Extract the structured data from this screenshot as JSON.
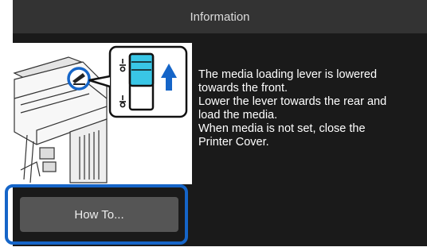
{
  "titlebar": {
    "title": "Information"
  },
  "message": {
    "text": "The media loading lever is lowered\ntowards the front.\nLower the lever towards the rear and\nload the media.\nWhen media is not set, close the\nPrinter Cover."
  },
  "actions": {
    "howto_label": "How To..."
  },
  "icons": {
    "printer": "printer-illustration",
    "lever_callout": "lever-position-icon",
    "arrow": "arrow-up-icon"
  },
  "colors": {
    "accent_blue": "#1565c8",
    "titlebar_bg": "#333333",
    "content_bg": "#1a1a1a",
    "button_bg": "#555555",
    "lever_cyan": "#39c6e6"
  }
}
